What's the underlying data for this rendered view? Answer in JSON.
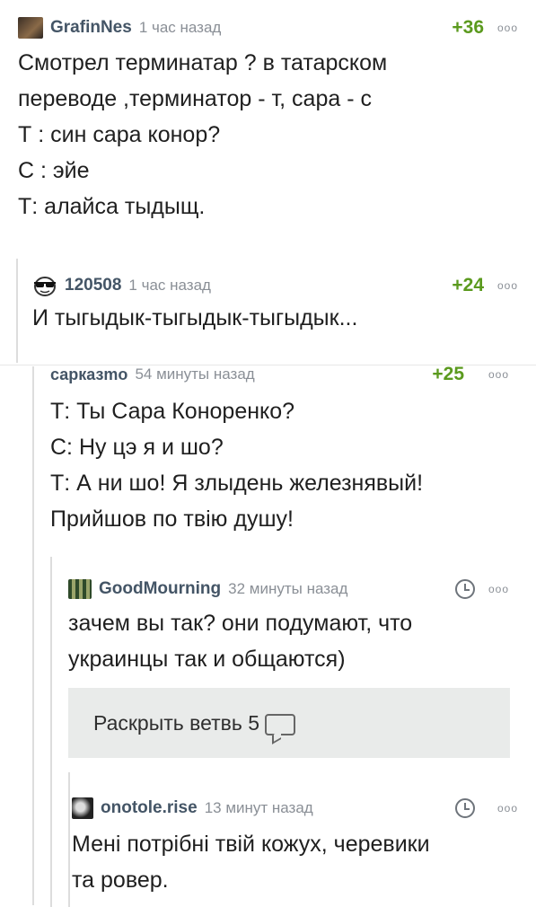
{
  "comments": [
    {
      "author": "GrafinNes",
      "time": "1 час назад",
      "rating": "+36",
      "more": "ooo",
      "avatar_icon": "dark-photo-avatar-icon",
      "lines": [
        "Смотрел терминатар ? в татарском",
        "переводе ,терминатор  - т, сара - с",
        "Т : син сара конор?",
        "С : эйе",
        "Т: алайса тыдыщ."
      ]
    },
    {
      "author": "120508",
      "time": "1 час назад",
      "rating": "+24",
      "more": "ooo",
      "avatar_icon": "sunglasses-face-icon",
      "lines": [
        "И тыгыдык-тыгыдык-тыгыдык..."
      ]
    },
    {
      "author": "сарказmo",
      "time": "54 минуты назад",
      "rating": "+25",
      "more": "ooo",
      "lines": [
        "Т: Ты Сара Коноренко?",
        "С: Ну цэ я и шо?",
        "Т: А ни шо! Я злыдень железнявый!",
        "Прийшов по твiю душу!"
      ]
    },
    {
      "author": "GoodMourning",
      "time": "32 минуты назад",
      "more": "ooo",
      "avatar_icon": "pixel-art-avatar-icon",
      "lines": [
        "зачем вы так? они подумают, что",
        "украинцы так и общаются)"
      ]
    },
    {
      "author": "onotole.rise",
      "time": "13 минут назад",
      "more": "ooo",
      "avatar_icon": "bw-photo-avatar-icon",
      "lines": [
        "Менi потрiбнi твiй кожух, черевики",
        "та ровер."
      ]
    }
  ],
  "expand_branch": {
    "label": "Раскрыть ветвь 5",
    "icon": "comment-bubble-icon"
  },
  "colors": {
    "author": "#445566",
    "rating": "#5b9a1e",
    "meta": "#8a8f96",
    "expand_bg": "#e9ebea"
  }
}
